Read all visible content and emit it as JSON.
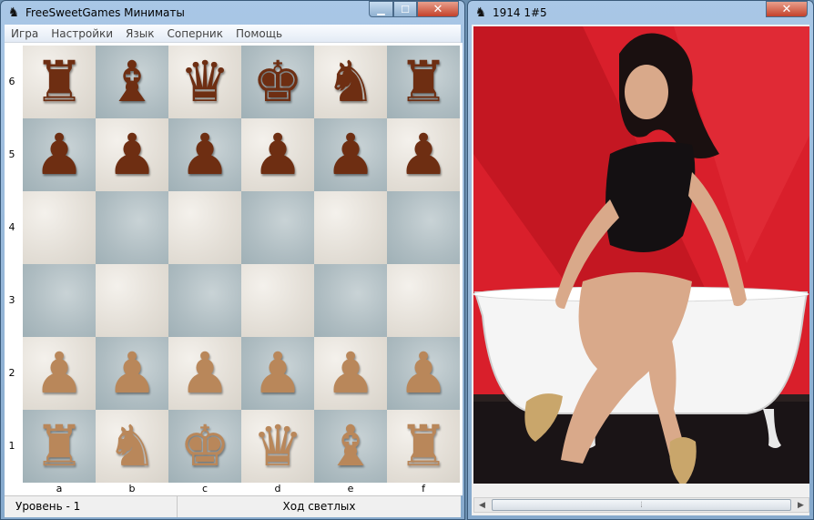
{
  "chess_window": {
    "title": "FreeSweetGames Миниматы",
    "menu": [
      "Игра",
      "Настройки",
      "Язык",
      "Соперник",
      "Помощь"
    ],
    "ranks": [
      "6",
      "5",
      "4",
      "3",
      "2",
      "1"
    ],
    "files": [
      "a",
      "b",
      "c",
      "d",
      "e",
      "f"
    ],
    "board": [
      [
        {
          "glyph": "♜",
          "side": "black",
          "name": "black-rook-icon"
        },
        {
          "glyph": "♝",
          "side": "black",
          "name": "black-bishop-icon"
        },
        {
          "glyph": "♛",
          "side": "black",
          "name": "black-queen-icon"
        },
        {
          "glyph": "♚",
          "side": "black",
          "name": "black-king-icon"
        },
        {
          "glyph": "♞",
          "side": "black",
          "name": "black-knight-icon"
        },
        {
          "glyph": "♜",
          "side": "black",
          "name": "black-rook-icon"
        }
      ],
      [
        {
          "glyph": "♟",
          "side": "black",
          "name": "black-pawn-icon"
        },
        {
          "glyph": "♟",
          "side": "black",
          "name": "black-pawn-icon"
        },
        {
          "glyph": "♟",
          "side": "black",
          "name": "black-pawn-icon"
        },
        {
          "glyph": "♟",
          "side": "black",
          "name": "black-pawn-icon"
        },
        {
          "glyph": "♟",
          "side": "black",
          "name": "black-pawn-icon"
        },
        {
          "glyph": "♟",
          "side": "black",
          "name": "black-pawn-icon"
        }
      ],
      [
        null,
        null,
        null,
        null,
        null,
        null
      ],
      [
        null,
        null,
        null,
        null,
        null,
        null
      ],
      [
        {
          "glyph": "♟",
          "side": "white",
          "name": "white-pawn-icon"
        },
        {
          "glyph": "♟",
          "side": "white",
          "name": "white-pawn-icon"
        },
        {
          "glyph": "♟",
          "side": "white",
          "name": "white-pawn-icon"
        },
        {
          "glyph": "♟",
          "side": "white",
          "name": "white-pawn-icon"
        },
        {
          "glyph": "♟",
          "side": "white",
          "name": "white-pawn-icon"
        },
        {
          "glyph": "♟",
          "side": "white",
          "name": "white-pawn-icon"
        }
      ],
      [
        {
          "glyph": "♜",
          "side": "white",
          "name": "white-rook-icon"
        },
        {
          "glyph": "♞",
          "side": "white",
          "name": "white-knight-icon"
        },
        {
          "glyph": "♚",
          "side": "white",
          "name": "white-king-icon"
        },
        {
          "glyph": "♛",
          "side": "white",
          "name": "white-queen-icon"
        },
        {
          "glyph": "♝",
          "side": "white",
          "name": "white-bishop-icon"
        },
        {
          "glyph": "♜",
          "side": "white",
          "name": "white-rook-icon"
        }
      ]
    ],
    "status_level": "Уровень - 1",
    "status_turn": "Ход светлых"
  },
  "image_window": {
    "title": "1914  1#5"
  },
  "colors": {
    "black_piece": "#6e2e12",
    "white_piece": "#b9875a",
    "photo_background": "#d91f2b"
  }
}
